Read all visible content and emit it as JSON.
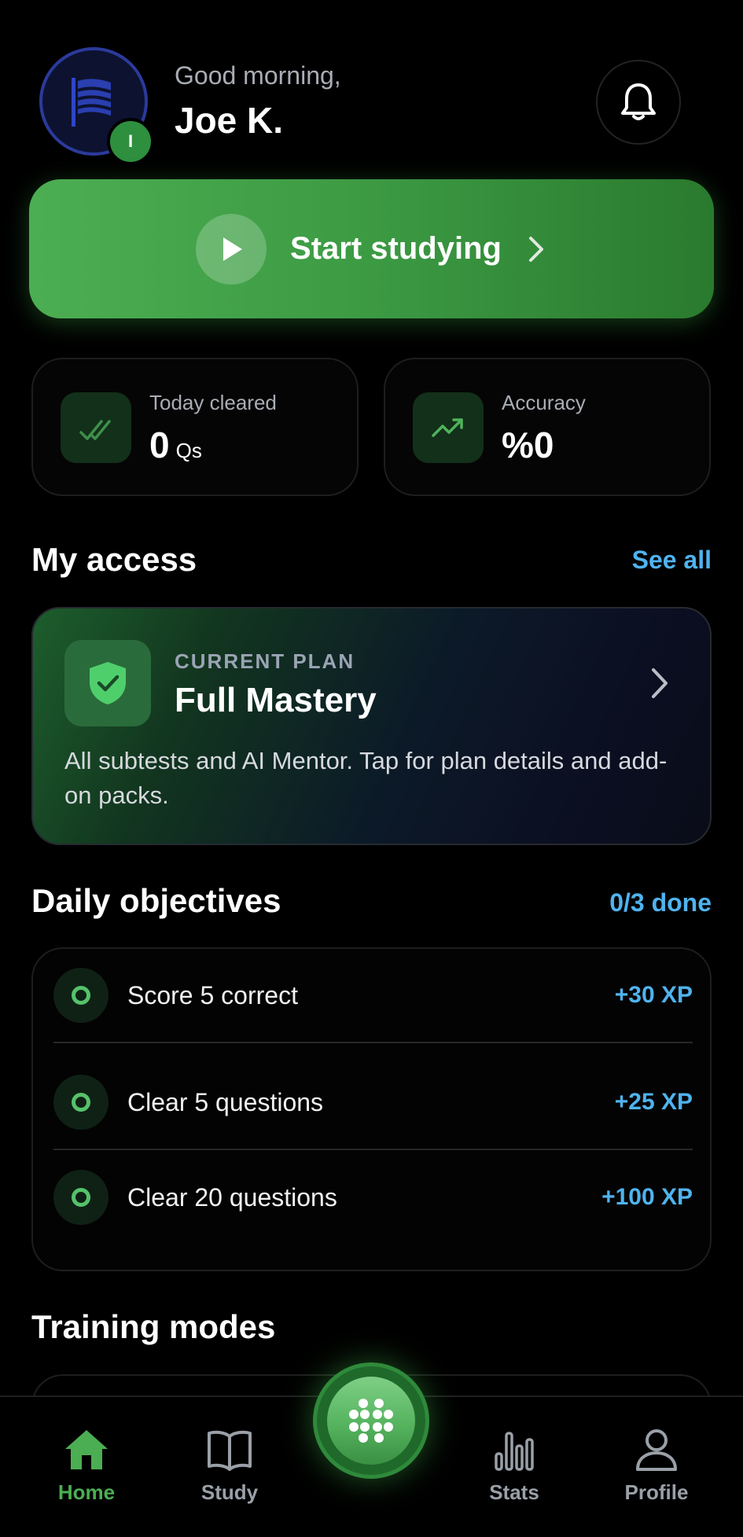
{
  "header": {
    "greeting": "Good morning,",
    "user_name": "Joe K.",
    "level_badge": "I"
  },
  "start": {
    "label": "Start studying"
  },
  "stats": {
    "today": {
      "label": "Today cleared",
      "value": "0",
      "unit": "Qs"
    },
    "accuracy": {
      "label": "Accuracy",
      "value": "%0"
    }
  },
  "access": {
    "title": "My access",
    "see_all": "See all",
    "plan": {
      "eyebrow": "CURRENT PLAN",
      "name": "Full Mastery",
      "description": "All subtests and AI Mentor. Tap for plan details and add-on packs."
    }
  },
  "objectives": {
    "title": "Daily objectives",
    "progress": "0/3 done",
    "items": [
      {
        "label": "Score 5 correct",
        "xp": "+30 XP"
      },
      {
        "label": "Clear 5 questions",
        "xp": "+25 XP"
      },
      {
        "label": "Clear 20 questions",
        "xp": "+100 XP"
      }
    ]
  },
  "training": {
    "title": "Training modes"
  },
  "nav": {
    "home": "Home",
    "study": "Study",
    "stats": "Stats",
    "profile": "Profile"
  },
  "colors": {
    "accent_green": "#4cae52",
    "accent_blue": "#4fb3ee",
    "background": "#000000"
  }
}
